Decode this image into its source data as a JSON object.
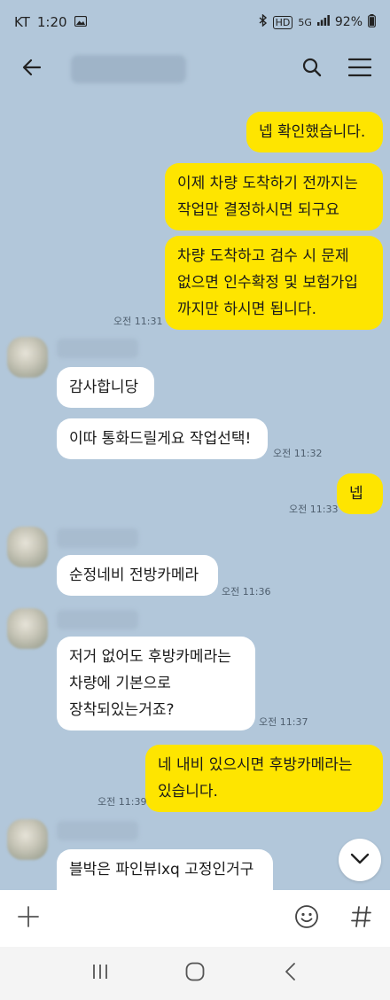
{
  "status_bar": {
    "carrier": "KT",
    "time": "1:20",
    "hd": "HD",
    "network": "5G",
    "battery": "92%"
  },
  "header": {
    "title": ""
  },
  "messages": [
    {
      "side": "me",
      "lines": [
        "넵 확인했습니다."
      ]
    },
    {
      "side": "me",
      "lines": [
        "이제 차량 도착하기 전까지는",
        "작업만 결정하시면 되구요"
      ]
    },
    {
      "side": "me",
      "lines": [
        "차량 도착하고 검수 시 문제",
        "없으면 인수확정 및 보험가입",
        "까지만 하시면 됩니다."
      ],
      "time": "오전 11:31"
    },
    {
      "side": "them",
      "lines": [
        "감사합니당"
      ]
    },
    {
      "side": "them",
      "lines": [
        "이따 통화드릴게요 작업선택!"
      ],
      "time": "오전 11:32"
    },
    {
      "side": "me",
      "lines": [
        "넵"
      ],
      "time": "오전 11:33"
    },
    {
      "side": "them",
      "lines": [
        "순정네비 전방카메라"
      ],
      "time": "오전 11:36"
    },
    {
      "side": "them",
      "lines": [
        "저거 없어도 후방카메라는",
        "차량에 기본으로",
        "장착되있는거죠?"
      ],
      "time": "오전 11:37"
    },
    {
      "side": "me",
      "lines": [
        "네 내비 있으시면 후방카메라는",
        "있습니다."
      ],
      "time": "오전 11:39"
    },
    {
      "side": "them",
      "lines": [
        "블박은 파인뷰lxq 고정인거구"
      ]
    }
  ],
  "input": {
    "placeholder": ""
  },
  "icons": {
    "back": "arrow-left-icon",
    "search": "search-icon",
    "menu": "hamburger-menu-icon",
    "scroll_down": "chevron-down-icon",
    "attach": "plus-icon",
    "emoji": "emoji-icon",
    "hashtag": "hashtag-icon",
    "recents": "recents-icon",
    "home": "home-icon",
    "nav_back": "nav-back-icon"
  },
  "colors": {
    "background": "#b2c7da",
    "my_bubble": "#fee500",
    "their_bubble": "#ffffff"
  }
}
